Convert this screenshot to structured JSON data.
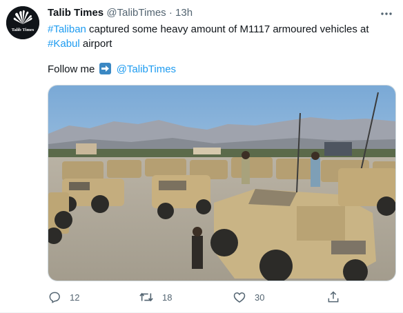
{
  "tweet": {
    "author_name": "Talib Times",
    "author_handle": "@TalibTimes",
    "separator": "·",
    "time": "13h",
    "avatar_text": "Talib Times",
    "text_part1": " captured some heavy amount of M1117 armoured vehicles at",
    "hashtag1": "#Taliban",
    "hashtag2": "#Kabul",
    "text_part2": " airport",
    "follow_label": "Follow me",
    "follow_mention": "@TalibTimes",
    "more_icon": "more-dots-icon"
  },
  "actions": {
    "replies": "12",
    "retweets": "18",
    "likes": "30"
  },
  "colors": {
    "link": "#1d9bf0",
    "secondary": "#536471",
    "arrow_box": "#3b88c3"
  }
}
